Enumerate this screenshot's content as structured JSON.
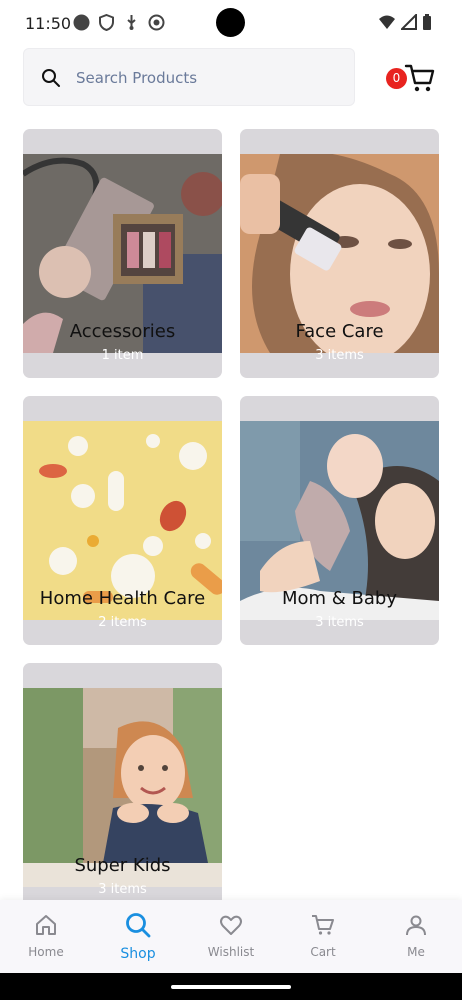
{
  "status_bar": {
    "time": "11:50"
  },
  "search": {
    "placeholder": "Search Products"
  },
  "cart": {
    "badge_count": "0"
  },
  "categories": [
    {
      "name": "Accessories",
      "count": "1 item"
    },
    {
      "name": "Face Care",
      "count": "3 items"
    },
    {
      "name": "Home Health Care",
      "count": "2 items"
    },
    {
      "name": "Mom & Baby",
      "count": "3 items"
    },
    {
      "name": "Super Kids",
      "count": "3 items"
    }
  ],
  "bottom_nav": [
    {
      "label": "Home",
      "icon": "home-icon"
    },
    {
      "label": "Shop",
      "icon": "search-icon",
      "active": true
    },
    {
      "label": "Wishlist",
      "icon": "heart-icon"
    },
    {
      "label": "Cart",
      "icon": "cart-icon"
    },
    {
      "label": "Me",
      "icon": "user-icon"
    }
  ],
  "colors": {
    "accent": "#1a8fe0",
    "badge": "#e8231f",
    "card_bg": "#d4d2d6"
  }
}
